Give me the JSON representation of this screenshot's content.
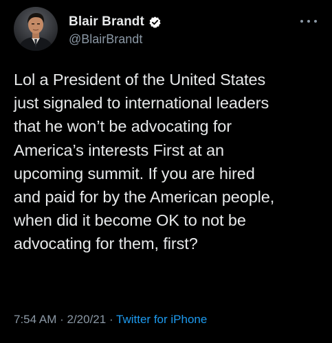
{
  "author": {
    "display_name": "Blair Brandt",
    "handle": "@BlairBrandt",
    "verified": true,
    "avatar_icon": "profile-photo"
  },
  "tweet": {
    "text": "Lol a President of the United States\njust signaled to international leaders\nthat he won’t be advocating for\nAmerica’s interests First at an\nupcoming summit. If you are hired\nand paid for by the American people,\nwhen did it become OK to not be\nadvocating for them, first?"
  },
  "meta": {
    "time": "7:54 AM",
    "separator": " · ",
    "date": "2/20/21",
    "source": "Twitter for iPhone"
  },
  "icons": {
    "more": "more-horizontal-icon",
    "verified": "verified-badge-icon"
  },
  "colors": {
    "background": "#000000",
    "text": "#e7e9ea",
    "secondary": "#8b98a5",
    "link": "#1d9bf0"
  }
}
